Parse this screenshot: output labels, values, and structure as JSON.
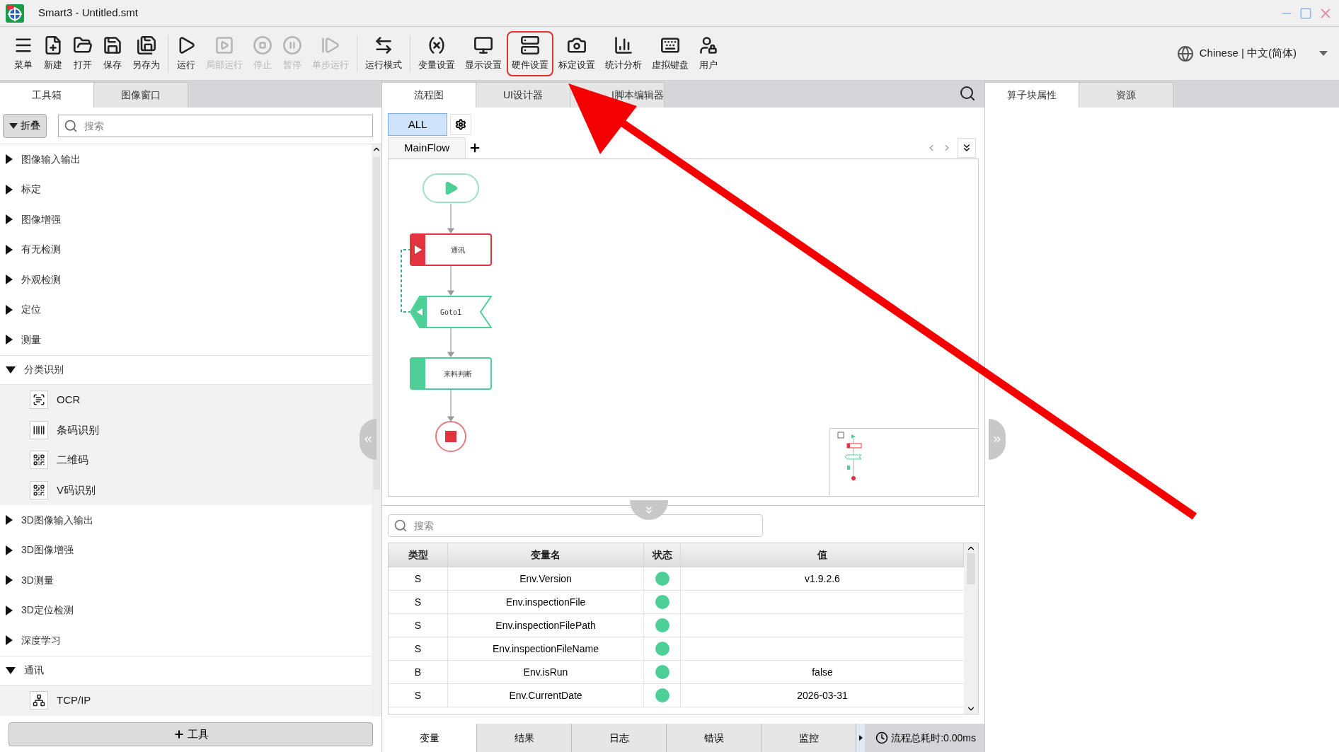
{
  "window": {
    "title": "Smart3 - Untitled.smt"
  },
  "toolbar": [
    {
      "label": "菜单",
      "disabled": false,
      "highlighted": false
    },
    {
      "label": "新建",
      "disabled": false,
      "highlighted": false
    },
    {
      "label": "打开",
      "disabled": false,
      "highlighted": false
    },
    {
      "label": "保存",
      "disabled": false,
      "highlighted": false
    },
    {
      "label": "另存为",
      "disabled": false,
      "highlighted": false
    },
    {
      "label": "运行",
      "disabled": false,
      "highlighted": false
    },
    {
      "label": "局部运行",
      "disabled": true,
      "highlighted": false
    },
    {
      "label": "停止",
      "disabled": true,
      "highlighted": false
    },
    {
      "label": "暂停",
      "disabled": true,
      "highlighted": false
    },
    {
      "label": "单步运行",
      "disabled": true,
      "highlighted": false
    },
    {
      "label": "运行模式",
      "disabled": false,
      "highlighted": false
    },
    {
      "label": "变量设置",
      "disabled": false,
      "highlighted": false
    },
    {
      "label": "显示设置",
      "disabled": false,
      "highlighted": false
    },
    {
      "label": "硬件设置",
      "disabled": false,
      "highlighted": true
    },
    {
      "label": "标定设置",
      "disabled": false,
      "highlighted": false
    },
    {
      "label": "统计分析",
      "disabled": false,
      "highlighted": false
    },
    {
      "label": "虚拟键盘",
      "disabled": false,
      "highlighted": false
    },
    {
      "label": "用户",
      "disabled": false,
      "highlighted": false
    }
  ],
  "language": "Chinese | 中文(简体)",
  "left_panel": {
    "tabs": [
      {
        "label": "工具箱",
        "selected": true
      },
      {
        "label": "图像窗口",
        "selected": false
      }
    ],
    "collapse_button": "折叠",
    "search": {
      "placeholder": "搜索"
    },
    "tree": [
      {
        "label": "图像输入输出",
        "expanded": false
      },
      {
        "label": "标定",
        "expanded": false
      },
      {
        "label": "图像增强",
        "expanded": false
      },
      {
        "label": "有无检测",
        "expanded": false
      },
      {
        "label": "外观检测",
        "expanded": false
      },
      {
        "label": "定位",
        "expanded": false
      },
      {
        "label": "测量",
        "expanded": false
      },
      {
        "label": "分类识别",
        "expanded": true,
        "children": [
          {
            "label": "OCR"
          },
          {
            "label": "条码识别"
          },
          {
            "label": "二维码"
          },
          {
            "label": "V码识别"
          }
        ]
      },
      {
        "label": "3D图像输入输出",
        "expanded": false
      },
      {
        "label": "3D图像增强",
        "expanded": false
      },
      {
        "label": "3D测量",
        "expanded": false
      },
      {
        "label": "3D定位检测",
        "expanded": false
      },
      {
        "label": "深度学习",
        "expanded": false
      },
      {
        "label": "通讯",
        "expanded": true,
        "children": [
          {
            "label": "TCP/IP"
          }
        ]
      }
    ],
    "add_tool_button": "工具"
  },
  "center": {
    "tabs": [
      {
        "label": "流程图",
        "selected": true
      },
      {
        "label": "UI设计器",
        "selected": false
      },
      {
        "label": "I脚本编辑器",
        "selected": false
      }
    ],
    "filter_button": "ALL",
    "flow_tabs": [
      {
        "label": "MainFlow",
        "selected": true
      }
    ],
    "flow": {
      "nodes": [
        {
          "kind": "start"
        },
        {
          "kind": "action",
          "label": "通讯",
          "color": "#e0343f"
        },
        {
          "kind": "goto",
          "label": "Goto1",
          "color": "#4fcf98"
        },
        {
          "kind": "action",
          "label": "来料判断",
          "color": "#4fcf98"
        },
        {
          "kind": "end"
        }
      ]
    },
    "variables": {
      "search": {
        "placeholder": "搜索"
      },
      "columns": [
        "类型",
        "变量名",
        "状态",
        "值"
      ],
      "rows": [
        {
          "type": "S",
          "name": "Env.Version",
          "color": "#4fcf98",
          "value": "v1.9.2.6"
        },
        {
          "type": "S",
          "name": "Env.inspectionFile",
          "color": "#4fcf98"
        },
        {
          "type": "S",
          "name": "Env.inspectionFilePath",
          "color": "#4fcf98"
        },
        {
          "type": "S",
          "name": "Env.inspectionFileName",
          "color": "#4fcf98"
        },
        {
          "type": "B",
          "name": "Env.isRun",
          "color": "#4fcf98",
          "value": "false"
        },
        {
          "type": "S",
          "name": "Env.CurrentDate",
          "color": "#4fcf98",
          "value": "2026-03-31"
        }
      ]
    },
    "bottom_tabs": [
      {
        "label": "变量",
        "selected": true
      },
      {
        "label": "结果",
        "selected": false
      },
      {
        "label": "日志",
        "selected": false
      },
      {
        "label": "错误",
        "selected": false
      },
      {
        "label": "监控",
        "selected": false
      }
    ],
    "status": "流程总耗时:0.00ms"
  },
  "right_panel": {
    "tabs": [
      {
        "label": "算子块属性",
        "selected": true
      },
      {
        "label": "资源",
        "selected": false
      }
    ]
  }
}
